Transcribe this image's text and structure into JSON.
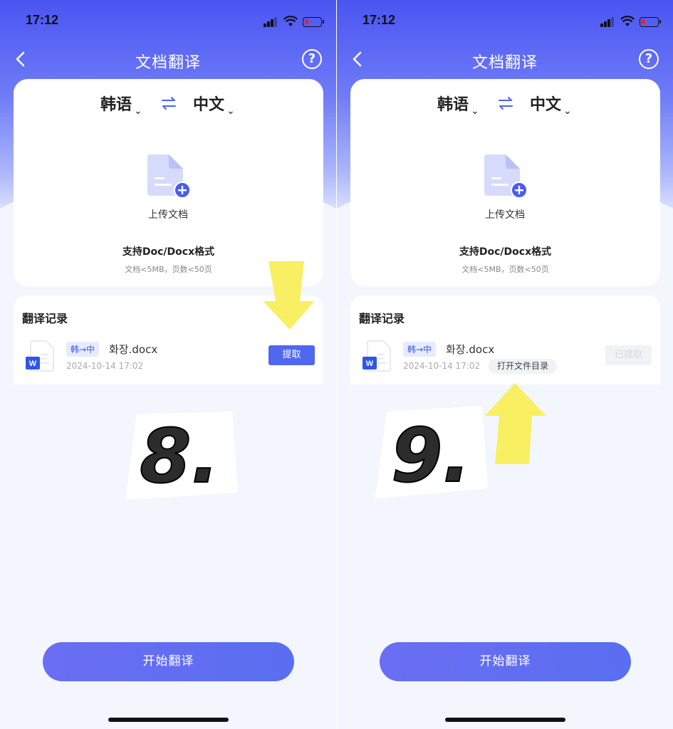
{
  "status": {
    "time": "17:12"
  },
  "nav": {
    "title": "文档翻译",
    "help": "?"
  },
  "languages": {
    "source": "韩语",
    "target": "中文"
  },
  "upload": {
    "label": "上传文档"
  },
  "formats": {
    "supported": "支持Doc/Docx格式",
    "limits": "文档<5MB，页数<50页"
  },
  "record": {
    "heading": "翻译记录",
    "tag": "韩→中",
    "file_name": "화장.docx",
    "date": "2024-10-14 17:02",
    "extract_label": "提取",
    "extracted_label": "已提取",
    "open_folder_label": "打开文件目录"
  },
  "start_button": "开始翻译",
  "steps": {
    "left": "8.",
    "right": "9."
  },
  "colors": {
    "accent": "#5167ef",
    "arrow": "#f9ef62"
  }
}
